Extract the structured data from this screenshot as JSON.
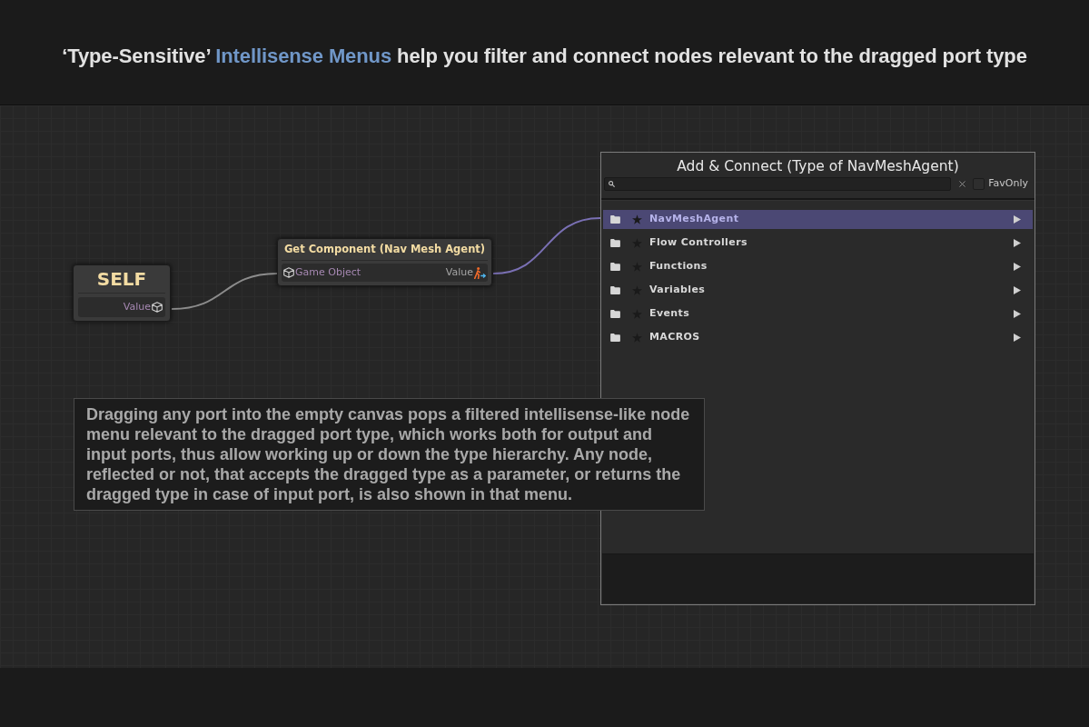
{
  "headline": {
    "segments": [
      {
        "text": "‘Type-Sensitive’ ",
        "highlight": false
      },
      {
        "text": "Intellisense Menus",
        "highlight": true
      },
      {
        "text": " help you filter and connect nodes relevant to the dragged port type",
        "highlight": false
      }
    ]
  },
  "canvas": {
    "self_node": {
      "title": "SELF",
      "output": {
        "label": "Value"
      }
    },
    "get_component_node": {
      "title": "Get Component (Nav Mesh Agent)",
      "input": {
        "label": "Game Object"
      },
      "output": {
        "label": "Value"
      }
    },
    "menu": {
      "title": "Add & Connect (Type of NavMeshAgent)",
      "fav_only": {
        "label": "FavOnly",
        "checked": false
      },
      "items": [
        {
          "label": "NavMeshAgent",
          "selected": true,
          "favorite": false
        },
        {
          "label": "Flow Controllers",
          "selected": false,
          "favorite": false
        },
        {
          "label": "Functions",
          "selected": false,
          "favorite": false
        },
        {
          "label": "Variables",
          "selected": false,
          "favorite": false
        },
        {
          "label": "Events",
          "selected": false,
          "favorite": false
        },
        {
          "label": "MACROS",
          "selected": false,
          "favorite": false
        }
      ]
    },
    "note": "Dragging any port into the empty canvas pops a filtered intellisense-like node menu relevant to the dragged port type, which works both for output and input ports, thus allow working up or down the type hierarchy. Any node, reflected or not, that accepts the dragged type as a parameter, or returns the dragged type in case of input port, is also shown in that menu."
  }
}
